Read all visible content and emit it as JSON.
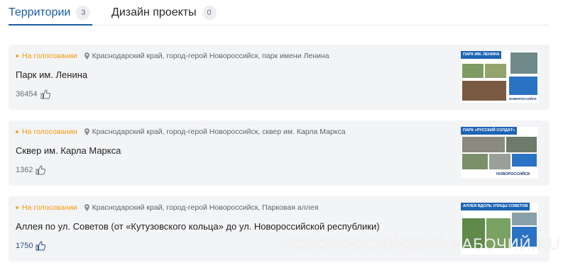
{
  "tabs": [
    {
      "label": "Территории",
      "count": "3"
    },
    {
      "label": "Дизайн проекты",
      "count": "0"
    }
  ],
  "cards": [
    {
      "status": "На голосовании",
      "address": "Краснодарский край, город-герой Новороссийск, парк имени Ленина",
      "title": "Парк им. Ленина",
      "likes": "36454",
      "thumb_banner": "ПАРК ИМ. ЛЕНИНА",
      "thumb_logo": "НОВОРОССИЙСК"
    },
    {
      "status": "На голосовании",
      "address": "Краснодарский край, город-герой Новороссийск, сквер им. Карла Маркса",
      "title": "Сквер им. Карла Маркса",
      "likes": "1362",
      "thumb_banner": "ПАРК «РУССКИЙ СОЛДАТ»",
      "thumb_logo": "НОВОРОССИЙСК"
    },
    {
      "status": "На голосовании",
      "address": "Краснодарский край, город-герой Новороссийск, Парковая аллея",
      "title": "Аллея по ул. Советов (от «Кутузовского кольца» до ул. Новороссийской республики)",
      "likes": "1750",
      "thumb_banner": "АЛЛЕЯ ВДОЛЬ УЛИЦЫ СОВЕТОВ",
      "thumb_logo": "НОВОРОССИЙСК"
    }
  ],
  "watermark": "НОВОРОССИЙСКИЙ-РАБОЧИЙ.RU",
  "colors": {
    "accent": "#1b5c9e",
    "status": "#f29a0e",
    "card_bg": "#f3f4f6"
  }
}
